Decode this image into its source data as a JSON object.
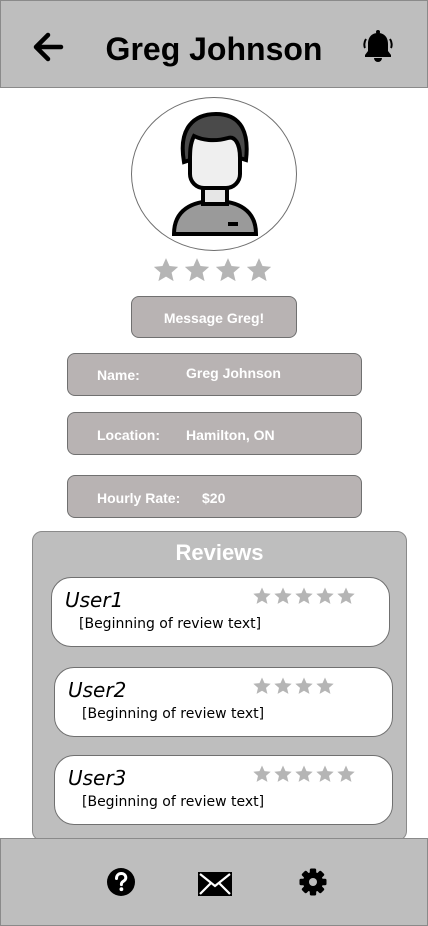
{
  "header": {
    "title": "Greg Johnson"
  },
  "profile": {
    "rating": 4,
    "message_button": "Message Greg!"
  },
  "info": {
    "name_label": "Name:",
    "name_value": "Greg Johnson",
    "location_label": "Location:",
    "location_value": "Hamilton, ON",
    "rate_label": "Hourly Rate:",
    "rate_value": "$20"
  },
  "reviews": {
    "title": "Reviews",
    "items": [
      {
        "user": "User1",
        "text": "[Beginning of review text]",
        "rating": 5
      },
      {
        "user": "User2",
        "text": "[Beginning of review text]",
        "rating": 4
      },
      {
        "user": "User3",
        "text": "[Beginning of review text]",
        "rating": 5
      }
    ]
  },
  "colors": {
    "bar": "#bebebe",
    "box": "#b8b3b3",
    "star": "#b5b5b5"
  },
  "icons": [
    "back-arrow-icon",
    "bell-icon",
    "help-icon",
    "mail-icon",
    "settings-icon"
  ]
}
